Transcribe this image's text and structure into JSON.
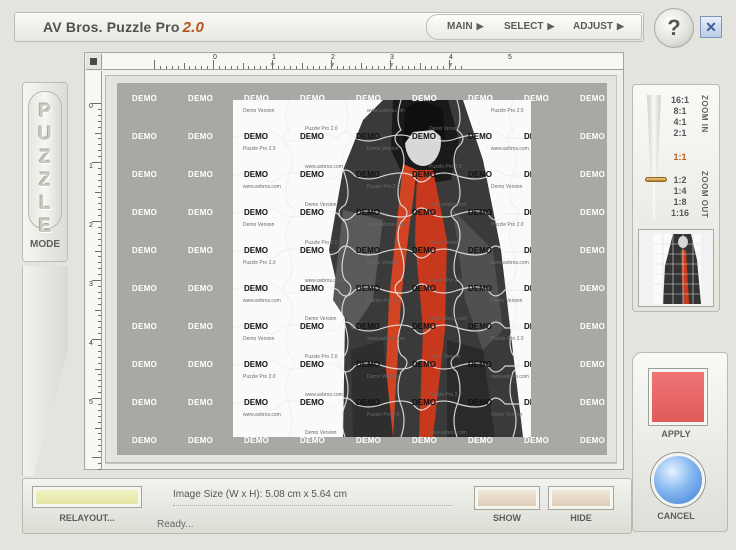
{
  "app": {
    "title": "AV Bros. Puzzle Pro",
    "version": "2.0"
  },
  "menu": {
    "items": [
      {
        "label": "MAIN",
        "arrow": "▶"
      },
      {
        "label": "SELECT",
        "arrow": "▶"
      },
      {
        "label": "ADJUST",
        "arrow": "▶"
      }
    ],
    "help_label": "?",
    "close_label": "✕"
  },
  "mode": {
    "letters": [
      "P",
      "U",
      "Z",
      "Z",
      "L",
      "E"
    ],
    "label": "MODE"
  },
  "ruler": {
    "top_numbers": [
      "0",
      "1",
      "2",
      "3",
      "4",
      "5"
    ],
    "left_numbers": [
      "0",
      "1",
      "2",
      "3",
      "4",
      "5"
    ]
  },
  "canvas": {
    "demo_label": "DEMO",
    "watermarks": [
      "Demo Version",
      "Puzzle Pro 2.0",
      "www.avbros.com"
    ]
  },
  "zoom": {
    "levels": [
      "16:1",
      "8:1",
      "4:1",
      "2:1",
      "1:1",
      "1:2",
      "1:4",
      "1:8",
      "1:16"
    ],
    "active": "1:1",
    "zoom_in_label": "ZOOM IN",
    "zoom_out_label": "ZOOM OUT"
  },
  "actions": {
    "apply_label": "APPLY",
    "cancel_label": "CANCEL",
    "show_label": "SHOW",
    "hide_label": "HIDE",
    "relayout_label": "RELAYOUT..."
  },
  "info": {
    "image_size": "Image Size (W x H): 5.08 cm x 5.64 cm",
    "status": "Ready..."
  },
  "colors": {
    "apply_button": "#e25b5b",
    "cancel_button": "#5a97e0",
    "relayout_button": "#e6e9aa",
    "show_hide_buttons": "#e4d6c2",
    "version_accent": "#b5551c",
    "canvas_background": "#a8a9a5"
  }
}
